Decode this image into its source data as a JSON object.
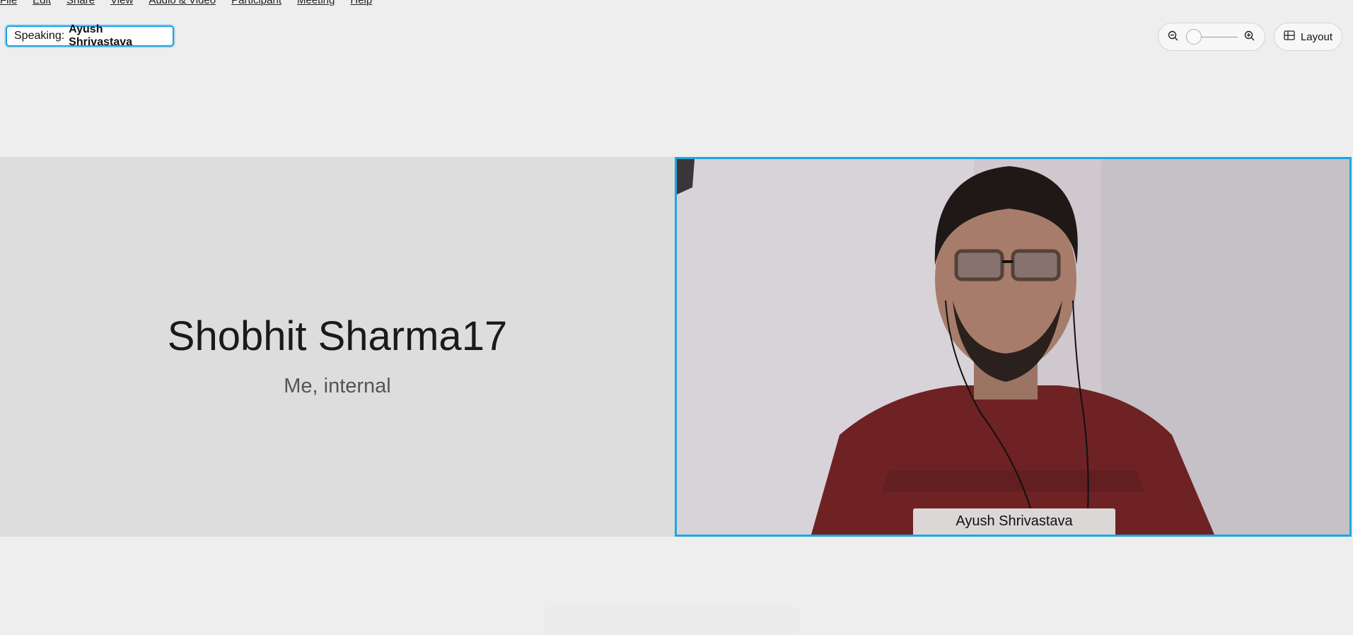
{
  "menu": [
    "File",
    "Edit",
    "Share",
    "View",
    "Audio & Video",
    "Participant",
    "Meeting",
    "Help"
  ],
  "speaking": {
    "label": "Speaking:",
    "name": "Ayush Shrivastava"
  },
  "zoom": {
    "zoom_out_icon": "zoom-out-icon",
    "zoom_in_icon": "zoom-in-icon",
    "level": 0
  },
  "layout_button": {
    "label": "Layout",
    "icon": "grid-icon"
  },
  "self_tile": {
    "name": "Shobhit Sharma17",
    "subtitle": "Me, internal"
  },
  "video_tile": {
    "participant_name": "Ayush Shrivastava",
    "active_speaker_border": "#1aa8e0"
  }
}
